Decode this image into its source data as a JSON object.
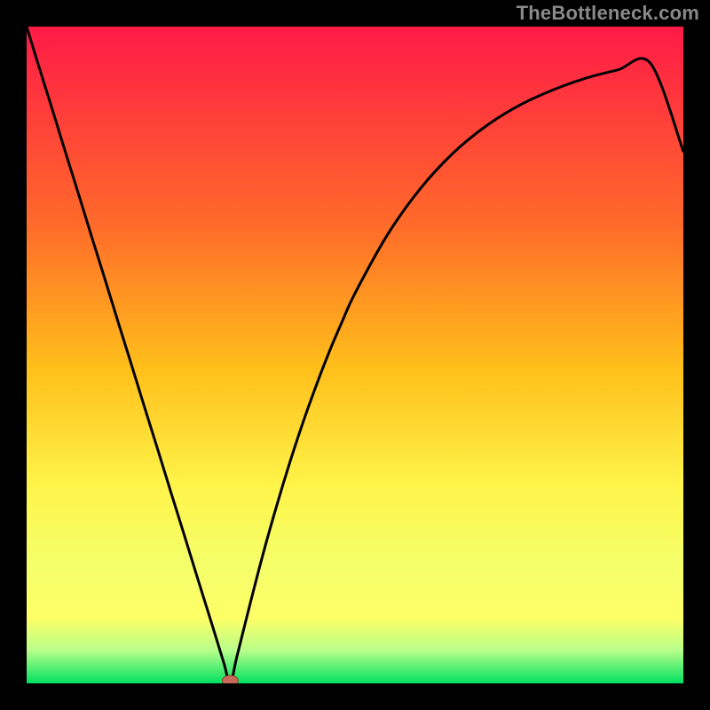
{
  "watermark": "TheBottleneck.com",
  "colors": {
    "bg_black": "#000000",
    "grad_top": "#ff1a47",
    "grad_mid1": "#ff6a2a",
    "grad_mid2": "#ffbf1a",
    "grad_mid3": "#fff44a",
    "grad_mid4": "#f4ff6a",
    "grad_band_yellow": "#ffff66",
    "grad_band_light": "#b8ff8a",
    "grad_bottom_green": "#00e060",
    "curve": "#000000",
    "marker_fill": "#c86a5a",
    "marker_stroke": "#8f3a2a"
  },
  "chart_data": {
    "type": "line",
    "title": "",
    "xlabel": "",
    "ylabel": "",
    "xlim": [
      0,
      1
    ],
    "ylim": [
      0,
      1
    ],
    "x": [
      0.0,
      0.02,
      0.04,
      0.06,
      0.08,
      0.1,
      0.12,
      0.14,
      0.16,
      0.18,
      0.2,
      0.22,
      0.24,
      0.26,
      0.28,
      0.3,
      0.31,
      0.32,
      0.34,
      0.36,
      0.38,
      0.4,
      0.42,
      0.44,
      0.46,
      0.48,
      0.5,
      0.55,
      0.6,
      0.65,
      0.7,
      0.75,
      0.8,
      0.85,
      0.9,
      0.95,
      1.0
    ],
    "y": [
      1.0,
      0.935,
      0.871,
      0.806,
      0.742,
      0.677,
      0.613,
      0.548,
      0.484,
      0.419,
      0.355,
      0.29,
      0.226,
      0.161,
      0.097,
      0.032,
      0.0,
      0.04,
      0.12,
      0.197,
      0.268,
      0.334,
      0.395,
      0.451,
      0.503,
      0.55,
      0.594,
      0.684,
      0.754,
      0.808,
      0.849,
      0.88,
      0.903,
      0.921,
      0.934,
      0.944,
      0.81
    ],
    "marker": {
      "x": 0.31,
      "y": 0.0
    },
    "annotations": []
  }
}
